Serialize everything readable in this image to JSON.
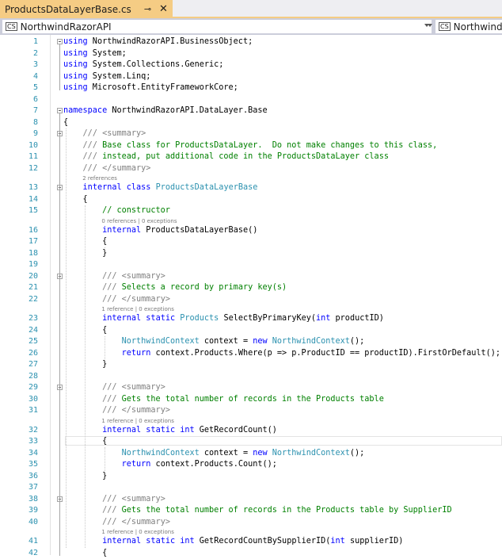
{
  "tab": {
    "title": "ProductsDataLayerBase.cs",
    "pin_icon": "pin-icon",
    "close_icon": "close-icon"
  },
  "navbar": {
    "project_icon": "CS",
    "project": "NorthwindRazorAPI",
    "class_icon": "CS",
    "class": "NorthwindRa"
  },
  "lines": [
    {
      "n": "1",
      "t": "using NorthwindRazorAPI.BusinessObject;"
    },
    {
      "n": "2",
      "t": "using System;"
    },
    {
      "n": "3",
      "t": "using System.Collections.Generic;"
    },
    {
      "n": "4",
      "t": "using System.Linq;"
    },
    {
      "n": "5",
      "t": "using Microsoft.EntityFrameworkCore;"
    },
    {
      "n": "6",
      "t": ""
    },
    {
      "n": "7",
      "t": "namespace NorthwindRazorAPI.DataLayer.Base"
    },
    {
      "n": "8",
      "t": "{"
    },
    {
      "n": "9",
      "t": "    /// <summary>"
    },
    {
      "n": "10",
      "t": "    /// Base class for ProductsDataLayer.  Do not make changes to this class,"
    },
    {
      "n": "11",
      "t": "    /// instead, put additional code in the ProductsDataLayer class"
    },
    {
      "n": "12",
      "t": "    /// </summary>"
    },
    {
      "n": "13",
      "t": "    internal class ProductsDataLayerBase"
    },
    {
      "n": "14",
      "t": "    {"
    },
    {
      "n": "15",
      "t": "        // constructor"
    },
    {
      "n": "16",
      "t": "        internal ProductsDataLayerBase()"
    },
    {
      "n": "17",
      "t": "        {"
    },
    {
      "n": "18",
      "t": "        }"
    },
    {
      "n": "19",
      "t": ""
    },
    {
      "n": "20",
      "t": "        /// <summary>"
    },
    {
      "n": "21",
      "t": "        /// Selects a record by primary key(s)"
    },
    {
      "n": "22",
      "t": "        /// </summary>"
    },
    {
      "n": "23",
      "t": "        internal static Products SelectByPrimaryKey(int productID)"
    },
    {
      "n": "24",
      "t": "        {"
    },
    {
      "n": "25",
      "t": "            NorthwindContext context = new NorthwindContext();"
    },
    {
      "n": "26",
      "t": "            return context.Products.Where(p => p.ProductID == productID).FirstOrDefault();"
    },
    {
      "n": "27",
      "t": "        }"
    },
    {
      "n": "28",
      "t": ""
    },
    {
      "n": "29",
      "t": "        /// <summary>"
    },
    {
      "n": "30",
      "t": "        /// Gets the total number of records in the Products table"
    },
    {
      "n": "31",
      "t": "        /// </summary>"
    },
    {
      "n": "32",
      "t": "        internal static int GetRecordCount()"
    },
    {
      "n": "33",
      "t": "        {"
    },
    {
      "n": "34",
      "t": "            NorthwindContext context = new NorthwindContext();"
    },
    {
      "n": "35",
      "t": "            return context.Products.Count();"
    },
    {
      "n": "36",
      "t": "        }"
    },
    {
      "n": "37",
      "t": ""
    },
    {
      "n": "38",
      "t": "        /// <summary>"
    },
    {
      "n": "39",
      "t": "        /// Gets the total number of records in the Products table by SupplierID"
    },
    {
      "n": "40",
      "t": "        /// </summary>"
    },
    {
      "n": "41",
      "t": "        internal static int GetRecordCountBySupplierID(int supplierID)"
    },
    {
      "n": "42",
      "t": "        {"
    }
  ],
  "codelens": [
    {
      "before": "13",
      "text": "2 references"
    },
    {
      "before": "16",
      "text": "0 references | 0 exceptions"
    },
    {
      "before": "23",
      "text": "1 reference | 0 exceptions"
    },
    {
      "before": "32",
      "text": "1 reference | 0 exceptions"
    },
    {
      "before": "41",
      "text": "1 reference | 0 exceptions"
    }
  ],
  "colors": {
    "keyword": "#0000ff",
    "type": "#2b91af",
    "comment": "#008000",
    "line_number": "#2b91af",
    "tab_active": "#f5cc84"
  }
}
